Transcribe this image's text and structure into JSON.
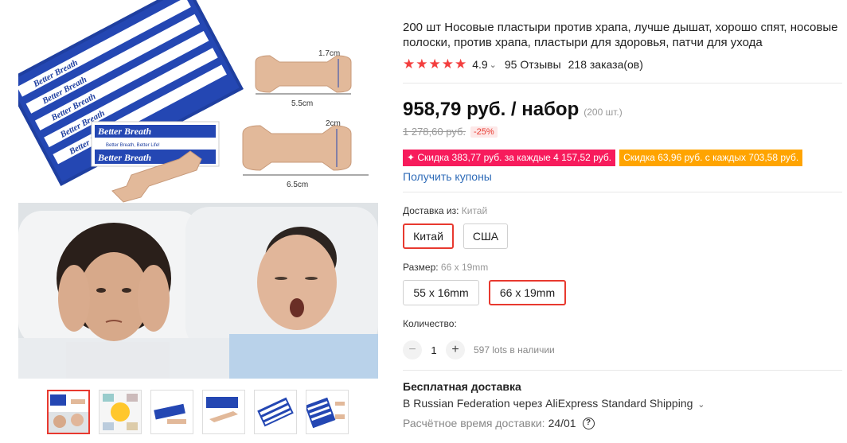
{
  "product": {
    "title": "200 шт Носовые пластыри против храпа, лучше дышат, хорошо спят, носовые полоски, против храпа, пластыри для здоровья, патчи для ухода",
    "rating": "4.9",
    "reviews": "95 Отзывы",
    "orders": "218 заказа(ов)"
  },
  "price": {
    "current": "958,79 руб. / набор",
    "unit": "(200 шт.)",
    "old": "1 278,60 руб.",
    "discount": "-25%"
  },
  "promos": {
    "red": "✦ Скидка 383,77 руб. за каждые 4 157,52 руб.",
    "orange": "Скидка 63,96 руб. с каждых 703,58 руб.",
    "coupons": "Получить купоны"
  },
  "shipping_from": {
    "label": "Доставка из:",
    "selected": "Китай",
    "options": [
      "Китай",
      "США"
    ]
  },
  "size": {
    "label": "Размер:",
    "selected": "66 x 19mm",
    "options": [
      "55 x 16mm",
      "66 x 19mm"
    ]
  },
  "quantity": {
    "label": "Количество:",
    "value": "1",
    "minus": "−",
    "plus": "+",
    "stock": "597 lots в наличии"
  },
  "delivery": {
    "title": "Бесплатная доставка",
    "line": "В Russian Federation через AliExpress Standard Shipping",
    "time_label": "Расчётное время доставки:",
    "time_value": "24/01",
    "help": "?"
  },
  "image_text": {
    "brand": "Better Breath",
    "slogan": "Better Breath, Better Life!",
    "dim_small_w": "1.7cm",
    "dim_small_l": "5.5cm",
    "dim_large_w": "2cm",
    "dim_large_l": "6.5cm"
  },
  "colors": {
    "accent": "#e8392f",
    "star": "#f33e3e",
    "promo_red": "#f71b5c",
    "promo_orange": "#ffa400",
    "link": "#2e6bb8"
  },
  "icons": [
    "star-icon",
    "chevron-down-icon",
    "help-icon"
  ]
}
